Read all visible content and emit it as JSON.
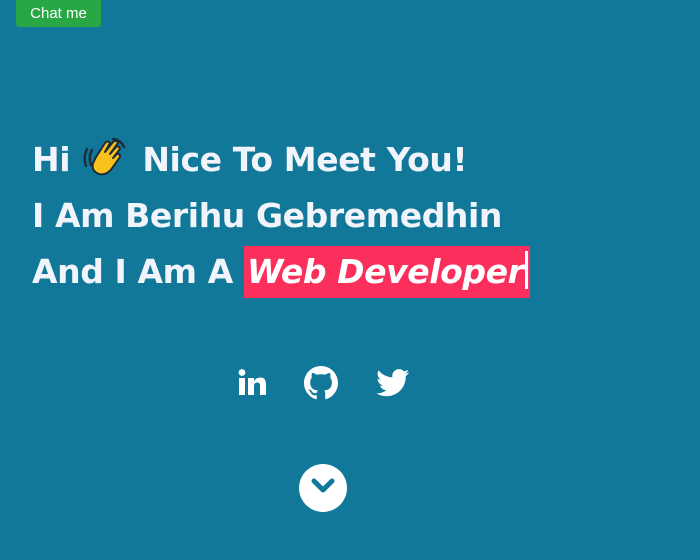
{
  "header": {
    "chat_label": "Chat me"
  },
  "hero": {
    "greeting_before": "Hi",
    "greeting_after": "Nice To Meet You!",
    "name_line": "I Am Berihu Gebremedhin",
    "role_prefix": "And I Am A",
    "role": "Web Developer"
  },
  "socials": [
    {
      "icon": "linkedin-icon"
    },
    {
      "icon": "github-icon"
    },
    {
      "icon": "twitter-icon"
    }
  ],
  "scroll": {
    "icon": "chevron-down-icon"
  },
  "colors": {
    "background": "#117899",
    "chat_button": "#28a745",
    "role_highlight": "#fa2f5c",
    "text": "#f1f5fb"
  }
}
